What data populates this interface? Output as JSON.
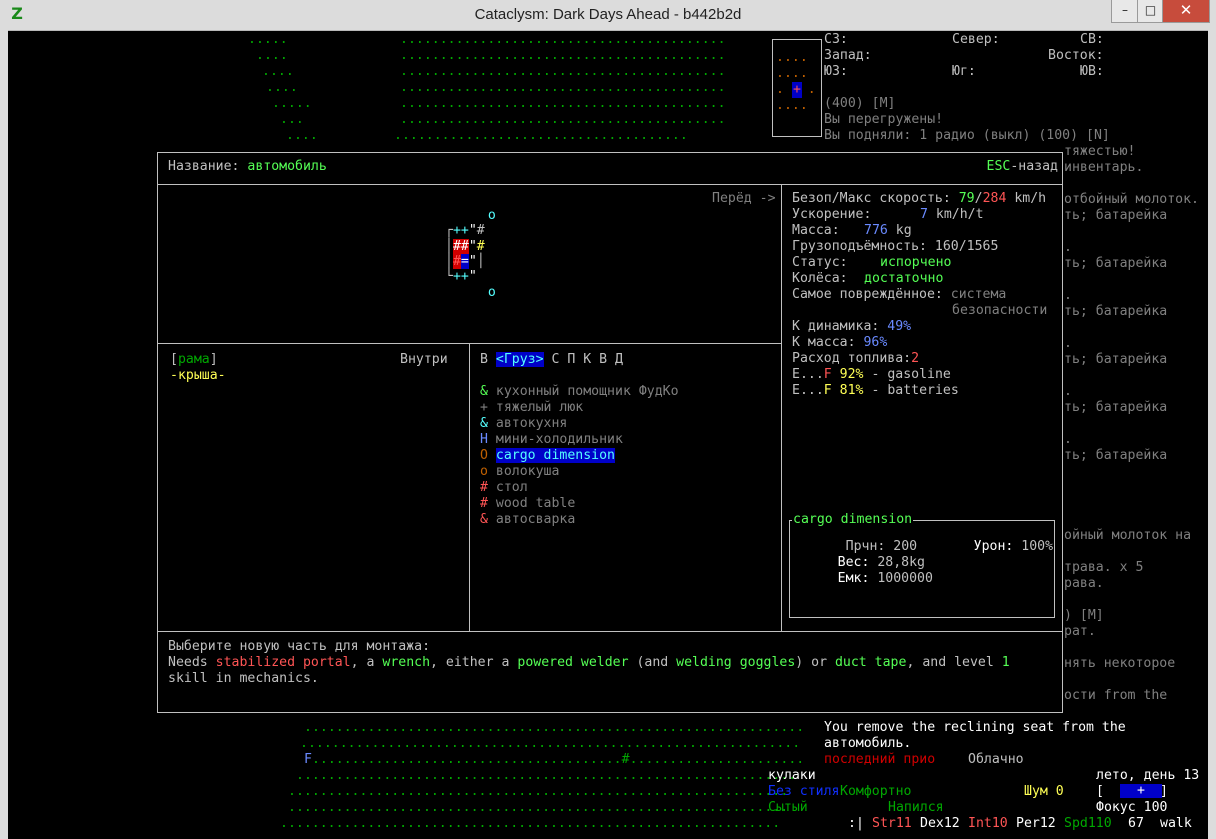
{
  "window": {
    "title": "Cataclysm: Dark Days Ahead - b442b2d",
    "icon": "Z",
    "min": "–",
    "max": "□",
    "close": "✕"
  },
  "map_top": [
    ".....",
    ". .   .....",
    "....",
    "....",
    ".....",
    "...",
    "....",
    ".........................................",
    ".........................................",
    ".........................................",
    ".........................................",
    ".........................................",
    ".........................................",
    "....................................."
  ],
  "compass": {
    "nw": "СЗ:",
    "n": "Север:",
    "ne": "СВ:",
    "w": "Запад:",
    "e": "Восток:",
    "sw": "ЮЗ:",
    "s": "Юг:",
    "se": "ЮВ:"
  },
  "minimap": {
    "rows": [
      "....",
      "....",
      "....",
      ". . .",
      "...."
    ],
    "player": "+"
  },
  "messages_top": [
    "(400) [M]",
    "Вы перегружены!",
    "Вы подняли: 1 радио (выкл) (100) [N]"
  ],
  "right_fragments": [
    "тяжестью!",
    "инвентарь.",
    "отбойный молоток.",
    "ть; батарейка",
    ".",
    "ть; батарейка",
    ".",
    "ть; батарейка",
    ".",
    "ть; батарейка",
    ".",
    "ть; батарейка",
    ".",
    "ть; батарейка",
    "ойный молоток на",
    "трава. х 5",
    "рава.",
    ") [M]",
    "рат.",
    "нять некоторое",
    "ости from the"
  ],
  "dialog": {
    "name_label": "Название: ",
    "name_value": "автомобиль",
    "esc_key": "ESC",
    "esc_label": "-назад",
    "forward": "Перёд ->",
    "vehicle_rows": [
      "  o",
      "++\"#",
      "##\"#",
      "#=\"",
      "++\"",
      "  o"
    ],
    "stats": {
      "speed_label": "Безоп/Макс скорость: ",
      "speed_safe": "79",
      "slash": "/",
      "speed_max": "284",
      "speed_unit": " km/h",
      "accel_label": "Ускорение:",
      "accel_value": "7",
      "accel_unit": " km/h/t",
      "mass_label": "Масса:",
      "mass_value": "776",
      "mass_unit": " kg",
      "cargo_label": "Грузоподъёмность: ",
      "cargo_value": "160/1565",
      "status_label": "Статус:",
      "status_value": "испорчено",
      "wheels_label": "Колёса:",
      "wheels_value": "достаточно",
      "damaged_label": "Самое повреждённое: ",
      "damaged_value1": "система",
      "damaged_value2": "безопасности",
      "kdyn_label": "К динамика: ",
      "kdyn_value": "49",
      "kmass_label": "К масса: ",
      "kmass_value": "96",
      "pct": "%",
      "fuel_label": "Расход топлива:",
      "fuel_value": "2",
      "tank1_e": "E...",
      "tank1_f": "F",
      "tank1_pct": "92%",
      "tank1_name": " - gasoline",
      "tank2_e": "E...",
      "tank2_f": "F",
      "tank2_pct": "81%",
      "tank2_name": " - batteries"
    },
    "parts": {
      "frame": "рама",
      "lbr": "[",
      "rbr": "]",
      "roof": "-крыша-",
      "inside": "Внутри"
    },
    "tabs": {
      "first": "В",
      "active": "<Груз>",
      "rest": "С П К В Д"
    },
    "install_list": [
      {
        "sym": "&",
        "name": "кухонный помощник ФудКо"
      },
      {
        "sym": "+",
        "name": "тяжелый люк"
      },
      {
        "sym": "&",
        "name": "автокухня"
      },
      {
        "sym": "H",
        "name": "мини-холодильник"
      },
      {
        "sym": "O",
        "name": "cargo dimension"
      },
      {
        "sym": "o",
        "name": "волокуша"
      },
      {
        "sym": "#",
        "name": "стол"
      },
      {
        "sym": "#",
        "name": "wood table"
      },
      {
        "sym": "&",
        "name": "автосварка"
      }
    ],
    "detail": {
      "title": "cargo dimension",
      "dur_label": "Прчн: ",
      "dur_value": "200",
      "dmg_label": "Урон: ",
      "dmg_value": "100%",
      "weight_label": "Вес: ",
      "weight_value": "28,8kg",
      "cap_label": "Емк: ",
      "cap_value": "1000000"
    },
    "requirements": {
      "line1": "Выберите новую часть для монтажа:",
      "needs": "Needs ",
      "item1": "stabilized portal",
      "sep1": ", a ",
      "item2": "wrench",
      "sep2": ", either a ",
      "item3": "powered welder",
      "sep3": " (and ",
      "item4": "welding goggles",
      "sep4": ") or ",
      "item5": "duct tape",
      "sep5": ", and level ",
      "level": "1",
      "line3": "skill in mechanics."
    }
  },
  "map_bottom": [
    "...............................................................",
    "...............................................................",
    "F.......................................#......................",
    "...............................................................",
    "...............................................................",
    "...............................................................",
    "..............................................................."
  ],
  "bottom_messages": {
    "line1": "You remove the reclining seat from the",
    "line2": "автомобиль.",
    "last_prio": "последний прио",
    "weather": "Облачно"
  },
  "sidebar": {
    "weapon": "кулаки",
    "style": "Без стиля",
    "comfort": "Комфортно",
    "noise_label": "Шум ",
    "noise_value": "0",
    "hunger": "Сытый",
    "thirst": "Напился",
    "season": "лето, день 13",
    "lbr": "[",
    "rbr": "]",
    "fuel_sym": "+",
    "focus": "Фокус 100",
    "stats_prefix": ":|",
    "str": "Str11",
    "dex": "Dex12",
    "int": "Int10",
    "per": "Per12",
    "spd": "Spd110",
    "mv": "67",
    "mode": "walk"
  }
}
